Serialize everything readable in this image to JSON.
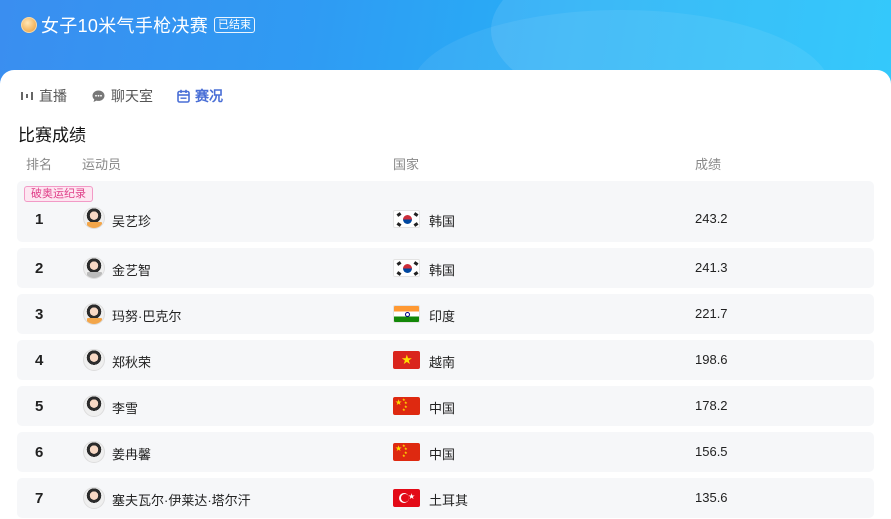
{
  "header": {
    "title": "女子10米气手枪决赛",
    "status_badge": "已结束"
  },
  "tabs": [
    {
      "label": "直播",
      "icon": "live-icon",
      "active": false
    },
    {
      "label": "聊天室",
      "icon": "chat-icon",
      "active": false
    },
    {
      "label": "赛况",
      "icon": "calendar-icon",
      "active": true
    }
  ],
  "section_title": "比赛成绩",
  "table": {
    "columns": {
      "rank": "排名",
      "athlete": "运动员",
      "country": "国家",
      "score": "成绩"
    },
    "record_tag": "破奥运纪录",
    "rows": [
      {
        "rank": "1",
        "athlete": "吴艺珍",
        "country": "韩国",
        "flag": "kr",
        "score": "243.2"
      },
      {
        "rank": "2",
        "athlete": "金艺智",
        "country": "韩国",
        "flag": "kr",
        "score": "241.3"
      },
      {
        "rank": "3",
        "athlete": "玛努·巴克尔",
        "country": "印度",
        "flag": "in",
        "score": "221.7"
      },
      {
        "rank": "4",
        "athlete": "郑秋荣",
        "country": "越南",
        "flag": "vn",
        "score": "198.6"
      },
      {
        "rank": "5",
        "athlete": "李雪",
        "country": "中国",
        "flag": "cn",
        "score": "178.2"
      },
      {
        "rank": "6",
        "athlete": "姜冉馨",
        "country": "中国",
        "flag": "cn",
        "score": "156.5"
      },
      {
        "rank": "7",
        "athlete": "塞夫瓦尔·伊莱达·塔尔汗",
        "country": "土耳其",
        "flag": "tr",
        "score": "135.6"
      }
    ]
  },
  "colors": {
    "header_gradient_start": "#3a8ef0",
    "header_gradient_end": "#1ec3fb",
    "active_tab": "#4a6fd6",
    "record_tag": "#e0408a",
    "row_bg": "#f6f7f9"
  }
}
